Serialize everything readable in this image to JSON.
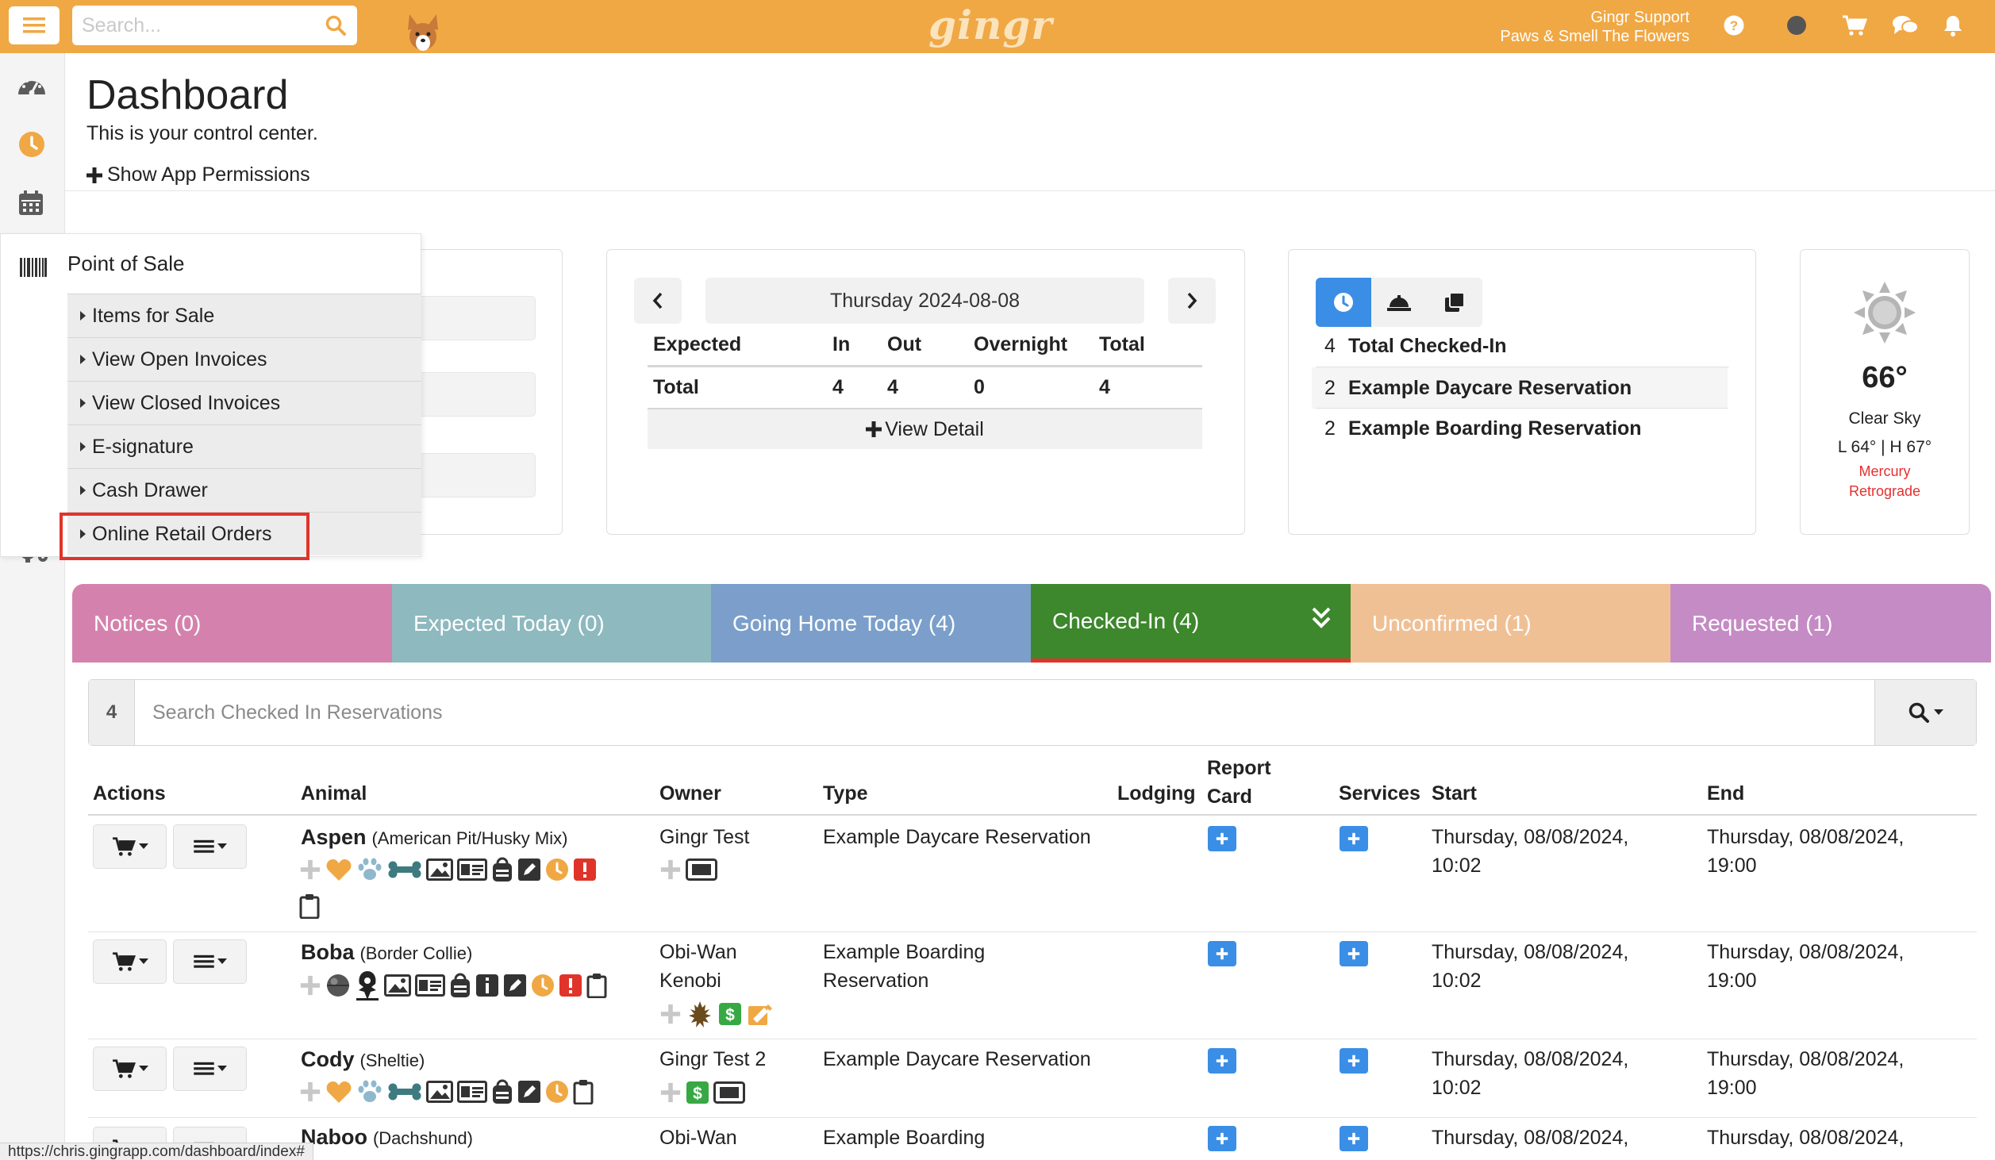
{
  "topbar": {
    "search_placeholder": "Search...",
    "logo_text": "gingr",
    "user_name": "Gingr Support",
    "business_name": "Paws & Smell The Flowers"
  },
  "header": {
    "title": "Dashboard",
    "subtitle": "This is your control center.",
    "permissions_link": "Show App Permissions"
  },
  "pos_menu": {
    "title": "Point of Sale",
    "items": [
      "Items for Sale",
      "View Open Invoices",
      "View Closed Invoices",
      "E-signature",
      "Cash Drawer",
      "Online Retail Orders"
    ]
  },
  "date_widget": {
    "date": "Thursday 2024-08-08",
    "columns": [
      "Expected",
      "In",
      "Out",
      "Overnight",
      "Total"
    ],
    "total_row": {
      "label": "Total",
      "in": "4",
      "out": "4",
      "overnight": "0",
      "total": "4"
    },
    "view_detail": "View Detail"
  },
  "checked_in_widget": {
    "rows": [
      {
        "count": "4",
        "label": "Total Checked-In"
      },
      {
        "count": "2",
        "label": "Example Daycare Reservation"
      },
      {
        "count": "2",
        "label": "Example Boarding Reservation"
      }
    ]
  },
  "weather": {
    "temp": "66°",
    "condition": "Clear Sky",
    "low_high": "L 64° | H 67°",
    "mercury_line1": "Mercury",
    "mercury_line2": "Retrograde"
  },
  "tabs": [
    {
      "label": "Notices (0)",
      "color": "#d482ad"
    },
    {
      "label": "Expected Today (0)",
      "color": "#8db9bf"
    },
    {
      "label": "Going Home Today (4)",
      "color": "#7b9fca"
    },
    {
      "label": "Checked-In (4)",
      "color": "#3d872c"
    },
    {
      "label": "Unconfirmed (1)",
      "color": "#f0c095"
    },
    {
      "label": "Requested (1)",
      "color": "#c58bc4"
    }
  ],
  "search": {
    "count": "4",
    "placeholder": "Search Checked In Reservations"
  },
  "table": {
    "headers": {
      "actions": "Actions",
      "animal": "Animal",
      "owner": "Owner",
      "type": "Type",
      "lodging": "Lodging",
      "report_card_1": "Report",
      "report_card_2": "Card",
      "services": "Services",
      "start": "Start",
      "end": "End"
    },
    "rows": [
      {
        "name": "Aspen",
        "breed": "(American Pit/Husky Mix)",
        "owner_1": "Gingr Test",
        "owner_2": "",
        "type_1": "Example Daycare Reservation",
        "type_2": "",
        "start_1": "Thursday, 08/08/2024,",
        "start_2": "10:02",
        "end_1": "Thursday, 08/08/2024,",
        "end_2": "19:00"
      },
      {
        "name": "Boba",
        "breed": "(Border Collie)",
        "owner_1": "Obi-Wan",
        "owner_2": "Kenobi",
        "type_1": "Example Boarding",
        "type_2": "Reservation",
        "start_1": "Thursday, 08/08/2024,",
        "start_2": "10:02",
        "end_1": "Thursday, 08/08/2024,",
        "end_2": "19:00"
      },
      {
        "name": "Cody",
        "breed": "(Sheltie)",
        "owner_1": "Gingr Test 2",
        "owner_2": "",
        "type_1": "Example Daycare Reservation",
        "type_2": "",
        "start_1": "Thursday, 08/08/2024,",
        "start_2": "10:02",
        "end_1": "Thursday, 08/08/2024,",
        "end_2": "19:00"
      },
      {
        "name": "Naboo",
        "breed": "(Dachshund)",
        "owner_1": "Obi-Wan",
        "owner_2": "",
        "type_1": "Example Boarding",
        "type_2": "",
        "start_1": "Thursday, 08/08/2024,",
        "start_2": "",
        "end_1": "Thursday, 08/08/2024,",
        "end_2": ""
      }
    ]
  },
  "status_url": "https://chris.gingrapp.com/dashboard/index#",
  "colors": {
    "topbar": "#f0a844",
    "accent_blue": "#3a8ee6",
    "orange": "#f0a844",
    "red": "#e0342a"
  }
}
